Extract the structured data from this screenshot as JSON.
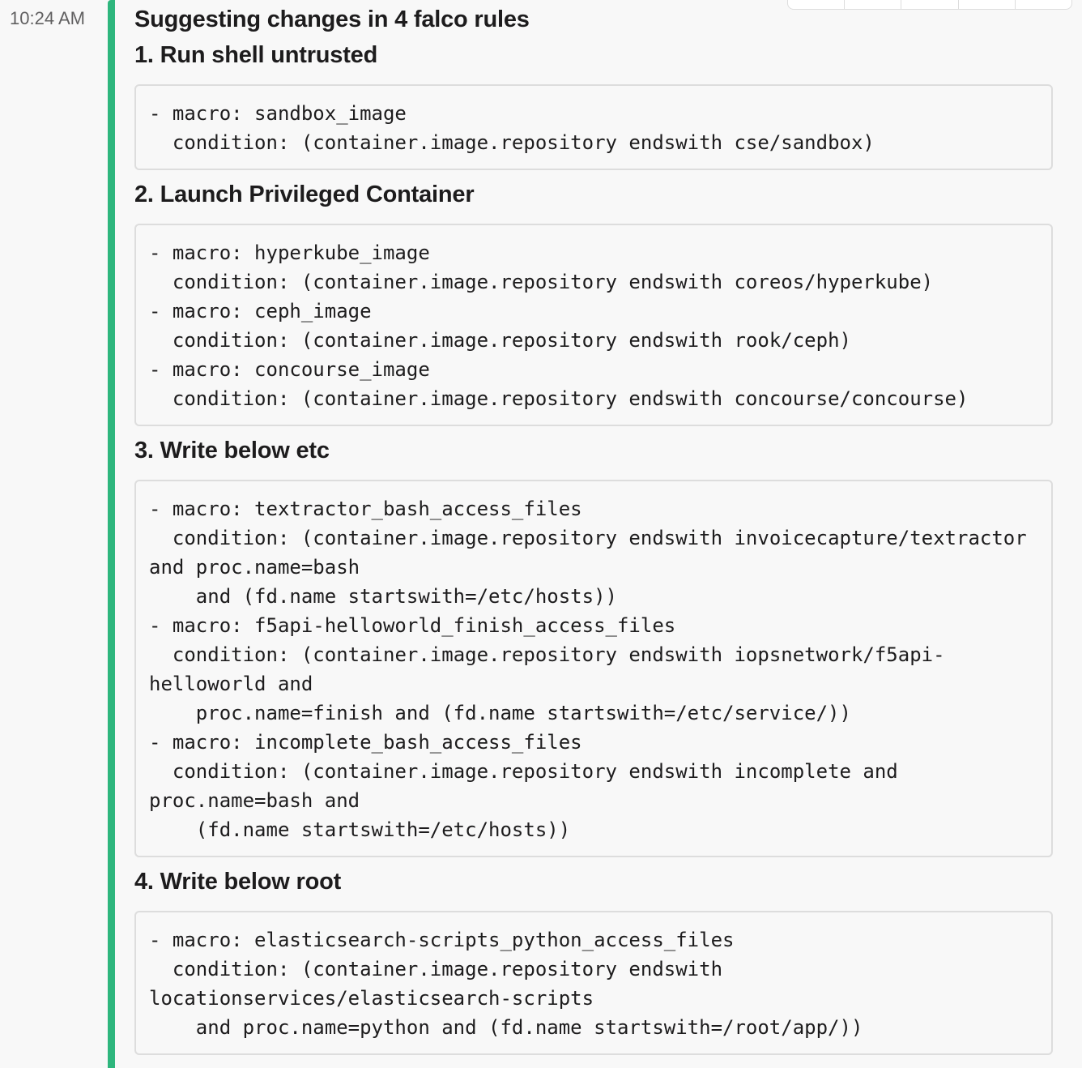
{
  "message": {
    "timestamp": "10:24 AM",
    "intro": "Suggesting changes in 4 falco rules",
    "rules": [
      {
        "title": "1. Run shell untrusted",
        "code": "- macro: sandbox_image\n  condition: (container.image.repository endswith cse/sandbox)"
      },
      {
        "title": "2. Launch Privileged Container",
        "code": "- macro: hyperkube_image\n  condition: (container.image.repository endswith coreos/hyperkube)\n- macro: ceph_image\n  condition: (container.image.repository endswith rook/ceph)\n- macro: concourse_image\n  condition: (container.image.repository endswith concourse/concourse)"
      },
      {
        "title": "3. Write below etc",
        "code": "- macro: textractor_bash_access_files\n  condition: (container.image.repository endswith invoicecapture/textractor\nand proc.name=bash\n    and (fd.name startswith=/etc/hosts))\n- macro: f5api-helloworld_finish_access_files\n  condition: (container.image.repository endswith iopsnetwork/f5api-\nhelloworld and\n    proc.name=finish and (fd.name startswith=/etc/service/))\n- macro: incomplete_bash_access_files\n  condition: (container.image.repository endswith incomplete and\nproc.name=bash and\n    (fd.name startswith=/etc/hosts))"
      },
      {
        "title": "4. Write below root",
        "code": "- macro: elasticsearch-scripts_python_access_files\n  condition: (container.image.repository endswith\nlocationservices/elasticsearch-scripts\n    and proc.name=python and (fd.name startswith=/root/app/))"
      }
    ]
  }
}
